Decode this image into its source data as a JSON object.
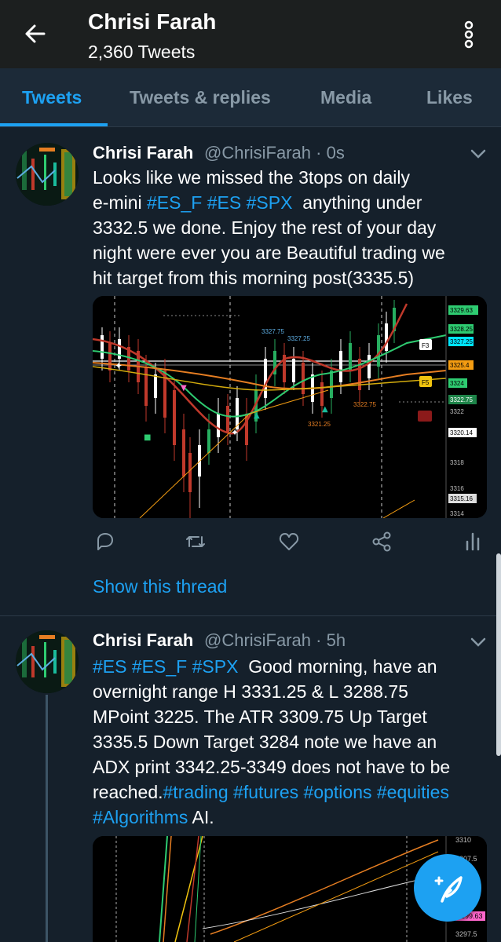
{
  "header": {
    "title": "Chrisi Farah",
    "subtitle": "2,360 Tweets"
  },
  "tabs": [
    {
      "label": "Tweets",
      "active": true
    },
    {
      "label": "Tweets & replies",
      "active": false
    },
    {
      "label": "Media",
      "active": false
    },
    {
      "label": "Likes",
      "active": false
    }
  ],
  "tweets": [
    {
      "name": "Chrisi Farah",
      "handle": "@ChrisiFarah",
      "time": "· 0s",
      "body": {
        "l1": "Looks like we missed the 3tops on daily",
        "l2a": "e-mini ",
        "tag1": "#ES_F",
        "tag2": "#ES",
        "tag3": "#SPX",
        "l2b": "  anything under",
        "l3": "3332.5 we done. Enjoy the rest of your day",
        "l4": "night were ever you are Beautiful trading we",
        "l5": "hit target from this morning post(3335.5)"
      },
      "chart_labels": {
        "p1": "3329.63",
        "p2": "3328.25",
        "p3": "3327.25",
        "p4": "3325.4",
        "p5": "3324",
        "p6": "3322.75",
        "p7": "3322",
        "p8": "3320.14",
        "p9": "3318",
        "p10": "3316",
        "p11": "3315.16",
        "p12": "3314",
        "a1": "3327.75",
        "a2": "3327.25",
        "a3": "3321.25",
        "a4": "3322.75",
        "f3": "F3",
        "f5": "F5"
      },
      "show_thread": "Show this thread"
    },
    {
      "name": "Chrisi Farah",
      "handle": "@ChrisiFarah",
      "time": "· 5h",
      "body": {
        "t1": "#ES",
        "t2": "#ES_F",
        "t3": "#SPX",
        "l1b": "  Good morning, have an",
        "l2": "overnight range H 3331.25 & L 3288.75",
        "l3": "MPoint 3225. The ATR 3309.75 Up Target",
        "l4": "3335.5 Down Target 3284 note we have an",
        "l5": "ADX print 3342.25-3349 does not have to be",
        "l6a": "reached.",
        "t4": "#trading",
        "t5": "#futures",
        "t6": "#options",
        "t7": "#equities",
        "t8": "#Algorithms",
        "l7b": " AI."
      },
      "chart_labels": {
        "q1": "3310",
        "q2": "3307.5",
        "q3": "3299.63",
        "q4": "3297.5"
      }
    }
  ],
  "colors": {
    "background": "#15202b",
    "accent": "#1da1f2",
    "secondary_text": "#8899a6"
  },
  "icons": [
    "back-arrow-icon",
    "more-vertical-icon",
    "chevron-down-icon",
    "reply-icon",
    "retweet-icon",
    "like-icon",
    "share-icon",
    "analytics-icon",
    "compose-tweet-icon"
  ]
}
